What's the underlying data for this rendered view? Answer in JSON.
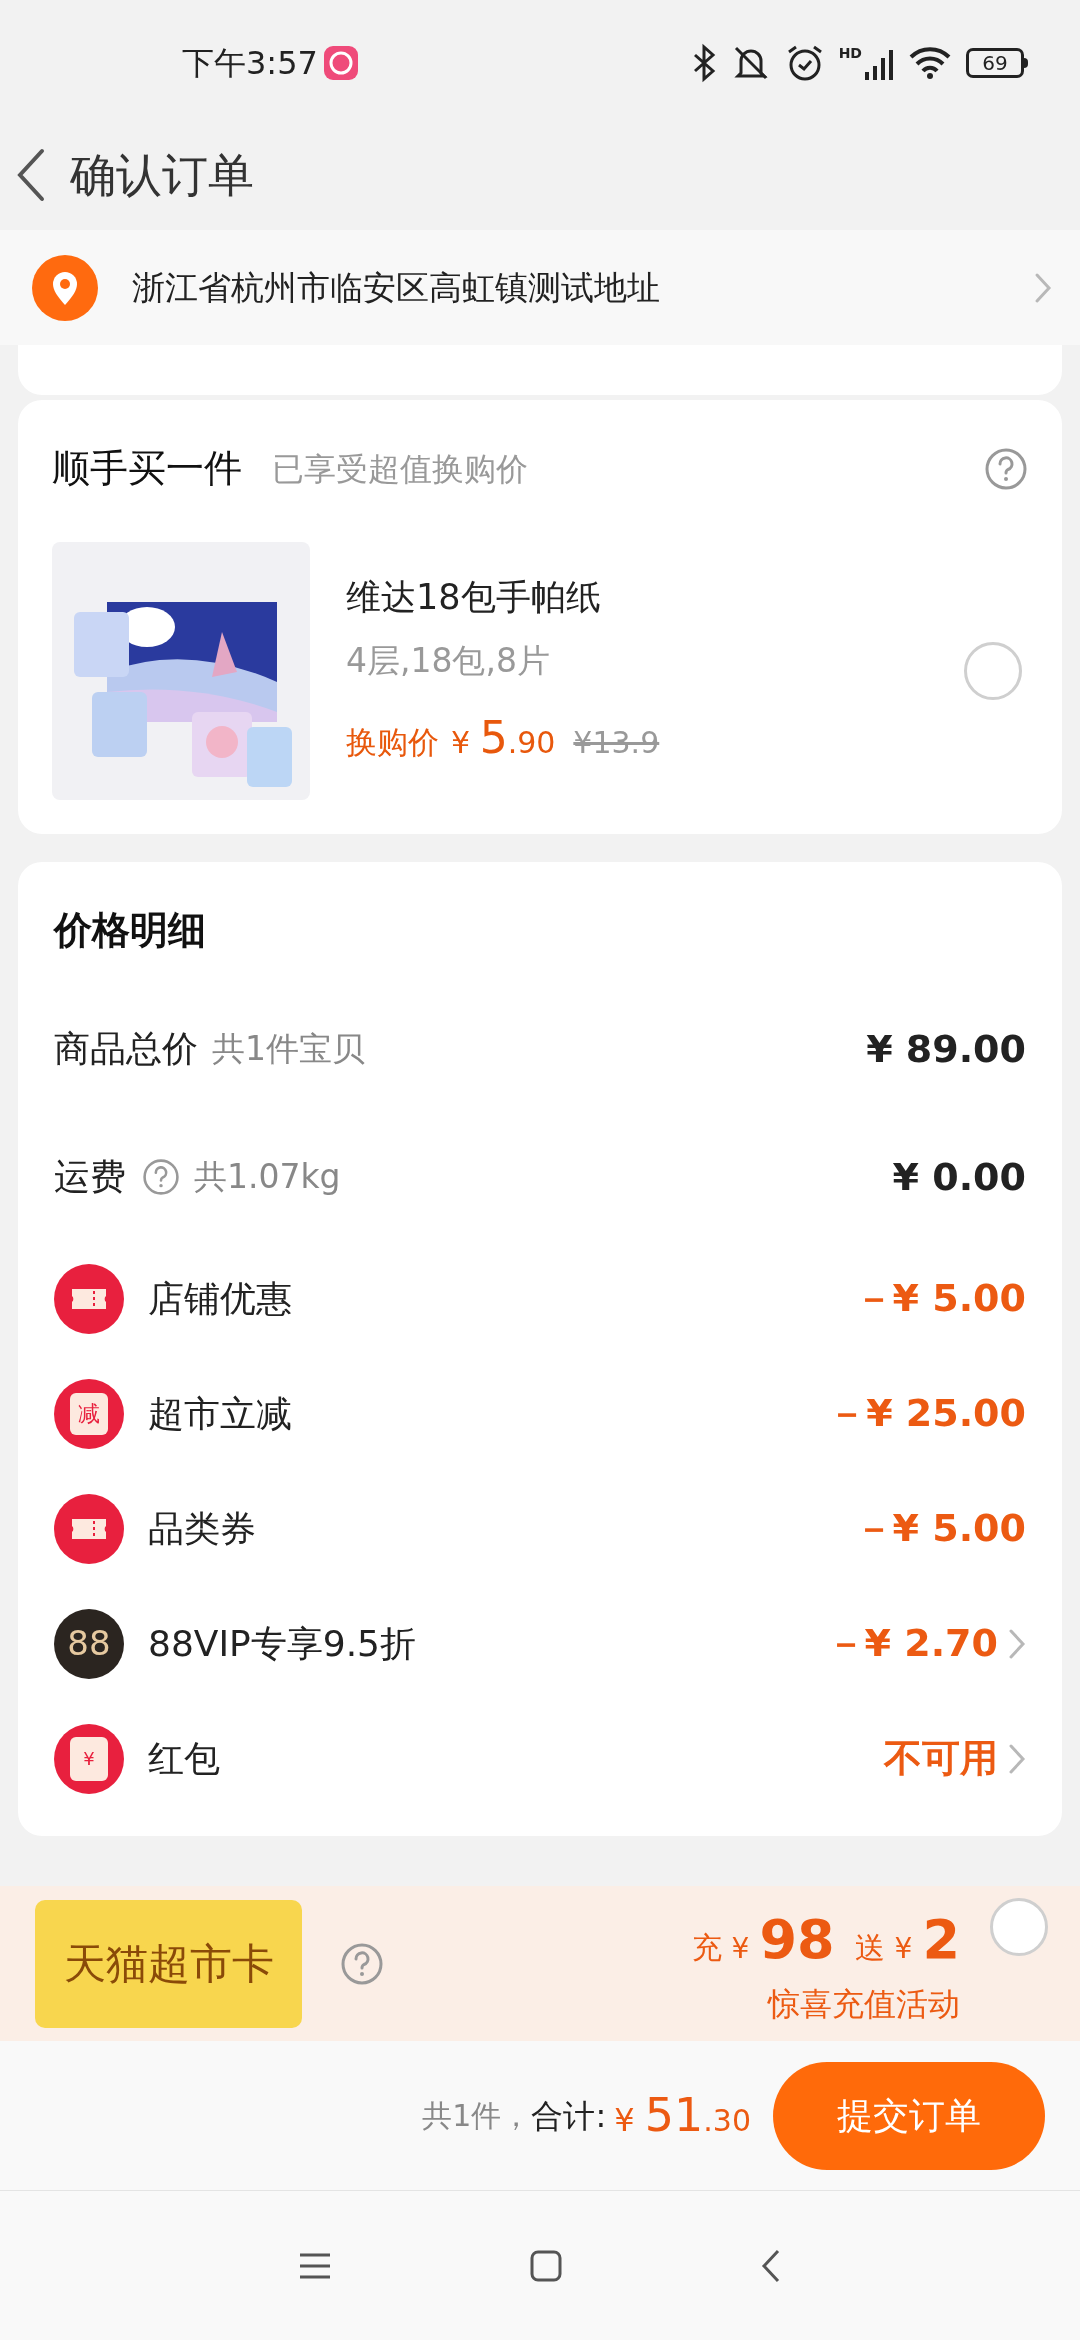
{
  "status_bar": {
    "time": "下午3:57",
    "battery": "69",
    "network": "HD"
  },
  "header": {
    "title": "确认订单"
  },
  "address": {
    "text": "浙江省杭州市临安区高虹镇测试地址"
  },
  "add_on": {
    "title": "顺手买一件",
    "subtitle": "已享受超值换购价",
    "item": {
      "name": "维达18包手帕纸",
      "spec": "4层,18包,8片",
      "price_label": "换购价",
      "currency": "¥",
      "integer": "5",
      "decimal": ".90",
      "original_price": "¥13.9",
      "selected": false
    }
  },
  "price_details": {
    "title": "价格明细",
    "rows": [
      {
        "kind": "plain",
        "label": "商品总价",
        "note": "共1件宝贝",
        "help": false,
        "value": "¥ 89.00",
        "chevron": false
      },
      {
        "kind": "plain",
        "label": "运费",
        "note": "共1.07kg",
        "help": true,
        "value": "¥ 0.00",
        "chevron": false
      },
      {
        "kind": "coupon",
        "label": "店铺优惠",
        "value": "－¥ 5.00",
        "chevron": false
      },
      {
        "kind": "instant",
        "icon_text": "减",
        "label": "超市立减",
        "value": "－¥ 25.00",
        "chevron": false
      },
      {
        "kind": "coupon",
        "label": "品类券",
        "value": "－¥ 5.00",
        "chevron": false
      },
      {
        "kind": "vip",
        "icon_text": "88",
        "label": "88VIP专享9.5折",
        "value": "－¥ 2.70",
        "chevron": true
      },
      {
        "kind": "packet",
        "icon_text": "¥",
        "label": "红包",
        "value": "不可用",
        "chevron": true
      }
    ]
  },
  "promo": {
    "card_label": "天猫超市卡",
    "charge_label": "充",
    "charge_currency": "¥",
    "charge_amount": "98",
    "bonus_label": "送",
    "bonus_currency": "¥",
    "bonus_amount": "2",
    "caption": "惊喜充值活动",
    "selected": false
  },
  "footer": {
    "count": "共1件，",
    "total_label": "合计:",
    "currency": "¥",
    "integer": "51",
    "decimal": ".30",
    "submit": "提交订单"
  }
}
